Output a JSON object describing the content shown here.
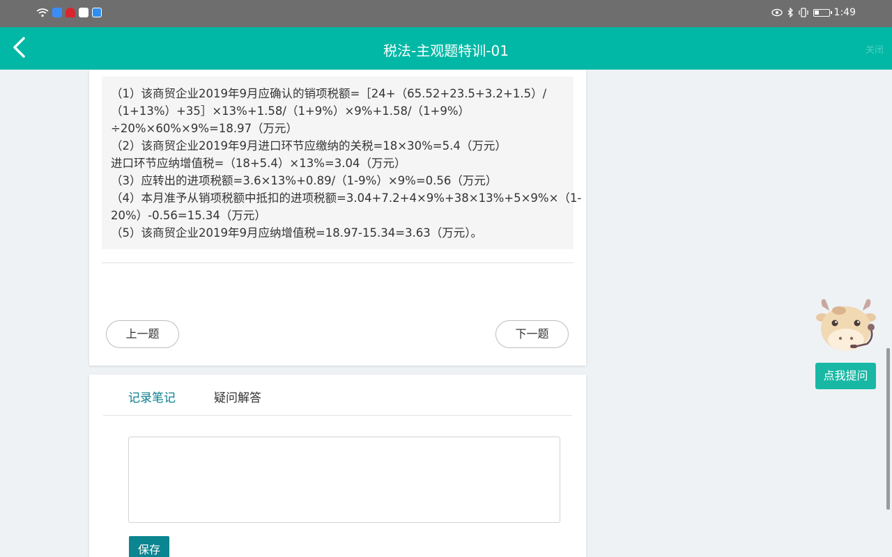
{
  "status_bar": {
    "time": "1:49",
    "left_icons": [
      "wifi-icon",
      "cloud-icon",
      "huawei-icon",
      "a-icon",
      "app-icon"
    ],
    "right_icons": [
      "eye-icon",
      "bluetooth-icon",
      "vibrate-icon",
      "battery-icon"
    ]
  },
  "header": {
    "title": "税法-主观题特训-01",
    "close_label": "关闭"
  },
  "answer": {
    "lines": [
      "（1）该商贸企业2019年9月应确认的销项税额=［24+（65.52+23.5+3.2+1.5）/",
      "（1+13%）+35］×13%+1.58/（1+9%）×9%+1.58/（1+9%）",
      "÷20%×60%×9%=18.97（万元）",
      "（2）该商贸企业2019年9月进口环节应缴纳的关税=18×30%=5.4（万元）",
      "进口环节应纳增值税=（18+5.4）×13%=3.04（万元）",
      "（3）应转出的进项税额=3.6×13%+0.89/（1-9%）×9%=0.56（万元）",
      "（4）本月准予从销项税额中抵扣的进项税额=3.04+7.2+4×9%+38×13%+5×9%×（1-",
      "20%）-0.56=15.34（万元）",
      "（5）该商贸企业2019年9月应纳增值税=18.97-15.34=3.63（万元）。"
    ]
  },
  "nav": {
    "prev_label": "上一题",
    "next_label": "下一题"
  },
  "notes": {
    "tabs": [
      {
        "label": "记录笔记",
        "active": true
      },
      {
        "label": "疑问解答",
        "active": false
      }
    ],
    "textarea_value": "",
    "save_label": "保存"
  },
  "helper": {
    "ask_label": "点我提问"
  },
  "colors": {
    "header": "#00b8a5",
    "active_tab": "#0b7f8e",
    "save_button": "#0b8590",
    "ask_button": "#18b8a5"
  }
}
